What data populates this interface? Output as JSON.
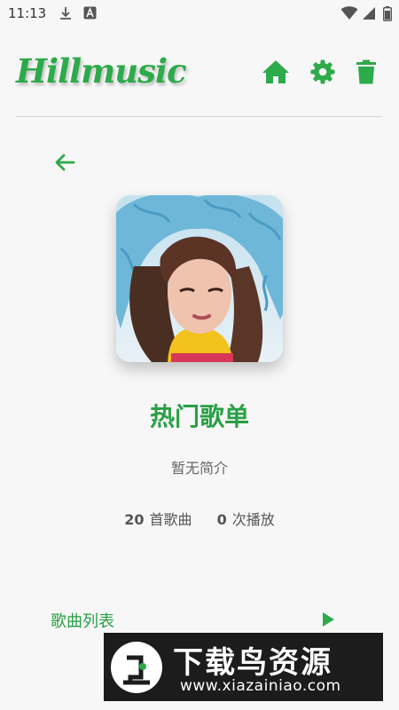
{
  "status_bar": {
    "time": "11:13"
  },
  "header": {
    "app_name": "Hillmusic",
    "home_icon": "home-icon",
    "settings_icon": "gear-icon",
    "delete_icon": "trash-icon"
  },
  "playlist": {
    "title": "热门歌单",
    "description": "暂无简介",
    "song_count": "20",
    "song_count_label": "首歌曲",
    "play_count": "0",
    "play_count_label": "次播放",
    "cover_icon": "playlist-cover-image"
  },
  "song_list": {
    "label": "歌曲列表"
  },
  "watermark": {
    "title": "下载鸟资源",
    "url": "www.xiazainiao.com"
  },
  "colors": {
    "accent": "#2daa4a",
    "background": "#f7f7f7"
  }
}
